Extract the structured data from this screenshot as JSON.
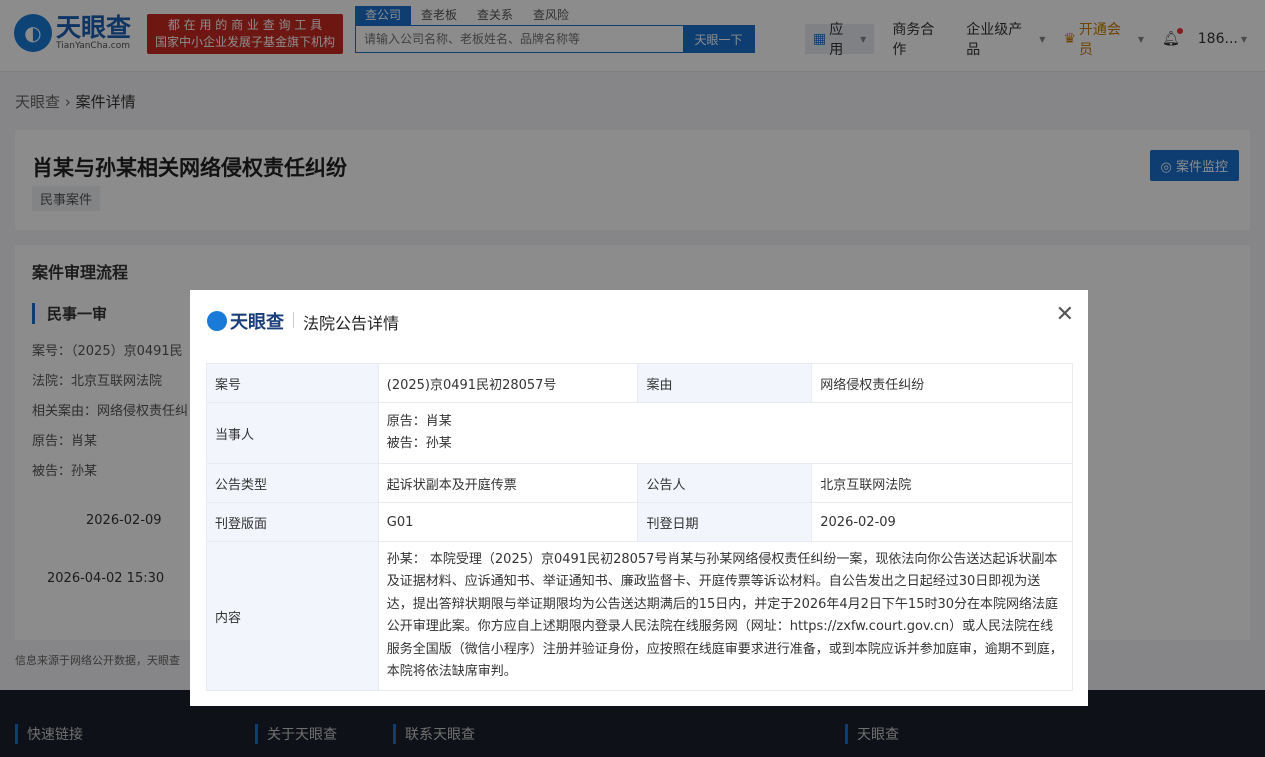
{
  "header": {
    "logo_cn": "天眼查",
    "logo_en": "TianYanCha.com",
    "promo_line1": "都 在 用 的 商 业 查 询 工 具",
    "promo_line2": "国家中小企业发展子基金旗下机构",
    "search_tabs": [
      "查公司",
      "查老板",
      "查关系",
      "查风险"
    ],
    "search_placeholder": "请输入公司名称、老板姓名、品牌名称等",
    "search_button": "天眼一下",
    "nav": {
      "apps": "应用",
      "business": "商务合作",
      "enterprise": "企业级产品",
      "vip": "开通会员",
      "user": "186..."
    }
  },
  "breadcrumb": {
    "home": "天眼查",
    "current": "案件详情"
  },
  "case": {
    "title": "肖某与孙某相关网络侵权责任纠纷",
    "tag": "民事案件",
    "monitor_button": "案件监控"
  },
  "process": {
    "title": "案件审理流程",
    "stage": "民事一审",
    "fields": [
      "案号：（2025）京0491民",
      "法院：北京互联网法院",
      "相关案由：网络侵权责任纠",
      "原告：肖某",
      "被告：孙某"
    ],
    "timeline": [
      "2026-02-09",
      "2026-04-02 15:30"
    ]
  },
  "info_text": "信息来源于网络公开数据，天眼查",
  "footer": {
    "links": [
      "快速链接",
      "关于天眼查",
      "联系天眼查",
      "天眼查"
    ]
  },
  "modal": {
    "logo": "天眼查",
    "title": "法院公告详情",
    "rows": {
      "case_no_label": "案号",
      "case_no": "(2025)京0491民初28057号",
      "cause_label": "案由",
      "cause": "网络侵权责任纠纷",
      "party_label": "当事人",
      "plaintiff": "原告：肖某",
      "defendant": "被告：孙某",
      "type_label": "公告类型",
      "type": "起诉状副本及开庭传票",
      "announcer_label": "公告人",
      "announcer": "北京互联网法院",
      "page_label": "刊登版面",
      "page": "G01",
      "date_label": "刊登日期",
      "date": "2026-02-09",
      "content_label": "内容",
      "content": "孙某：  本院受理（2025）京0491民初28057号肖某与孙某网络侵权责任纠纷一案，现依法向你公告送达起诉状副本及证据材料、应诉通知书、举证通知书、廉政监督卡、开庭传票等诉讼材料。自公告发出之日起经过30日即视为送达，提出答辩状期限与举证期限均为公告送达期满后的15日内，并定于2026年4月2日下午15时30分在本院网络法庭公开审理此案。你方应自上述期限内登录人民法院在线服务网（网址：https://zxfw.court.gov.cn）或人民法院在线服务全国版（微信小程序）注册并验证身份，应按照在线庭审要求进行准备，或到本院应诉并参加庭审，逾期不到庭，本院将依法缺席审判。"
    }
  }
}
